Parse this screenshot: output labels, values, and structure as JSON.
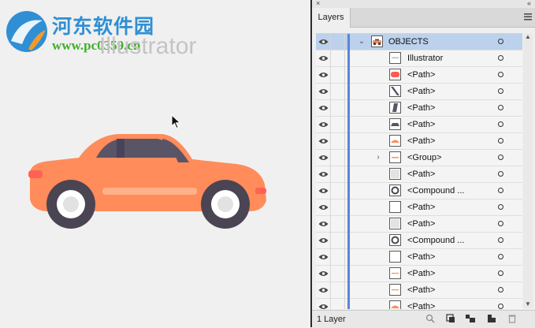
{
  "watermark": {
    "site_name": "河东软件园",
    "url": "www.pc0359.cn"
  },
  "canvas": {
    "text_object": "Illustrator"
  },
  "panel": {
    "collapse_glyph": "«",
    "close_glyph": "×",
    "tab_label": "Layers",
    "layer_count": "1 Layer",
    "scroll_up": "▲",
    "scroll_down": "▼"
  },
  "layers": [
    {
      "label": "OBJECTS",
      "chevron": "⌄",
      "level": 0,
      "selected": true,
      "thumb": "car-thumb"
    },
    {
      "label": "Illustrator",
      "chevron": "",
      "level": 1,
      "selected": false,
      "thumb": "text-thumb"
    },
    {
      "label": "<Path>",
      "chevron": "",
      "level": 1,
      "selected": false,
      "thumb": "red-shape-thumb"
    },
    {
      "label": "<Path>",
      "chevron": "",
      "level": 1,
      "selected": false,
      "thumb": "dark-stripe-thumb"
    },
    {
      "label": "<Path>",
      "chevron": "",
      "level": 1,
      "selected": false,
      "thumb": "dark-window-thumb"
    },
    {
      "label": "<Path>",
      "chevron": "",
      "level": 1,
      "selected": false,
      "thumb": "dark-roof-thumb"
    },
    {
      "label": "<Path>",
      "chevron": "",
      "level": 1,
      "selected": false,
      "thumb": "orange-dome-thumb"
    },
    {
      "label": "<Group>",
      "chevron": "›",
      "level": 1,
      "selected": false,
      "thumb": "group-thumb"
    },
    {
      "label": "<Path>",
      "chevron": "",
      "level": 1,
      "selected": false,
      "thumb": "gray-thumb"
    },
    {
      "label": "<Compound ...",
      "chevron": "",
      "level": 1,
      "selected": false,
      "thumb": "wheel-thumb"
    },
    {
      "label": "<Path>",
      "chevron": "",
      "level": 1,
      "selected": false,
      "thumb": "blank-thumb"
    },
    {
      "label": "<Path>",
      "chevron": "",
      "level": 1,
      "selected": false,
      "thumb": "gray-thumb"
    },
    {
      "label": "<Compound ...",
      "chevron": "",
      "level": 1,
      "selected": false,
      "thumb": "wheel-thumb"
    },
    {
      "label": "<Path>",
      "chevron": "",
      "level": 1,
      "selected": false,
      "thumb": "blank-thumb"
    },
    {
      "label": "<Path>",
      "chevron": "",
      "level": 1,
      "selected": false,
      "thumb": "orange-line-thumb"
    },
    {
      "label": "<Path>",
      "chevron": "",
      "level": 1,
      "selected": false,
      "thumb": "orange-line-thumb"
    },
    {
      "label": "<Path>",
      "chevron": "",
      "level": 1,
      "selected": false,
      "thumb": "orange-dome-thumb"
    }
  ],
  "colors": {
    "car_body": "#ff8c5a",
    "car_highlight": "#ffb28a",
    "car_window": "#5a5566",
    "tire": "#4a4453",
    "hub": "#e2e2e2",
    "selection": "#bcd1ec",
    "layer_color_bar": "#5b85d8"
  }
}
